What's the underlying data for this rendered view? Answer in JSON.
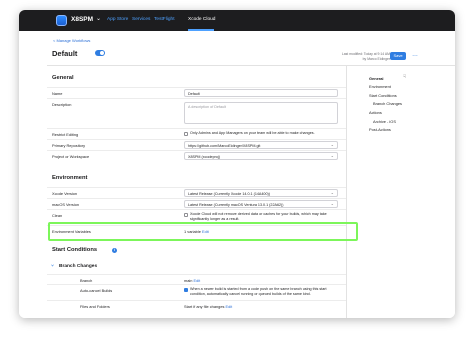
{
  "header": {
    "app_name": "X8SPM",
    "nav": [
      "App Store",
      "Services",
      "TestFlight",
      "Xcode Cloud"
    ]
  },
  "page": {
    "back_link": "< Manage Workflows",
    "workflow_name": "Default",
    "status_line1": "Last modified: Today at 9:14 AM",
    "status_line2": "by Marco Eidinger",
    "save": "Save",
    "more": "…"
  },
  "general": {
    "title": "General",
    "name_label": "Name",
    "name_value": "Default",
    "description_label": "Description",
    "description_placeholder": "A description of Default",
    "restrict_label": "Restrict Editing",
    "restrict_text": "Only Admins and App Managers on your team will be able to make changes.",
    "repo_label": "Primary Repository",
    "repo_value": "https://github.com/MarcoEidinger/X8SPM.git",
    "project_label": "Project or Workspace",
    "project_value": "X8SPM (xcodeproj)"
  },
  "environment": {
    "title": "Environment",
    "xcode_label": "Xcode Version",
    "xcode_value": "Latest Release (Currently Xcode 14.0.1 (14A400))",
    "macos_label": "macOS Version",
    "macos_value": "Latest Release (Currently macOS Ventura 13.0.1 (22A62))",
    "clean_label": "Clean",
    "clean_text": "Xcode Cloud will not remove derived data or caches for your builds, which may take significantly longer as a result.",
    "env_vars_label": "Environment Variables",
    "env_vars_value": "1 variable",
    "env_vars_edit": "Edit"
  },
  "start_conditions": {
    "title": "Start Conditions",
    "branch_title": "Branch Changes",
    "branch_label": "Branch",
    "branch_value": "main",
    "branch_edit": "Edit",
    "auto_cancel_label": "Auto-cancel Builds",
    "auto_cancel_text": "When a newer build is started from a code push on the same branch using this start condition, automatically cancel running or queued builds of the same kind.",
    "files_label": "Files and Folders",
    "files_value": "Start if any file changes",
    "files_edit": "Edit"
  },
  "right_nav": {
    "items": [
      "General",
      "Environment",
      "Start Conditions",
      "Branch Changes",
      "Actions",
      "Archive - iOS",
      "Post-Actions"
    ]
  },
  "colors": {
    "accent": "#2f7de1",
    "highlight": "#7cf65a",
    "topbar": "#1d1d1f"
  }
}
